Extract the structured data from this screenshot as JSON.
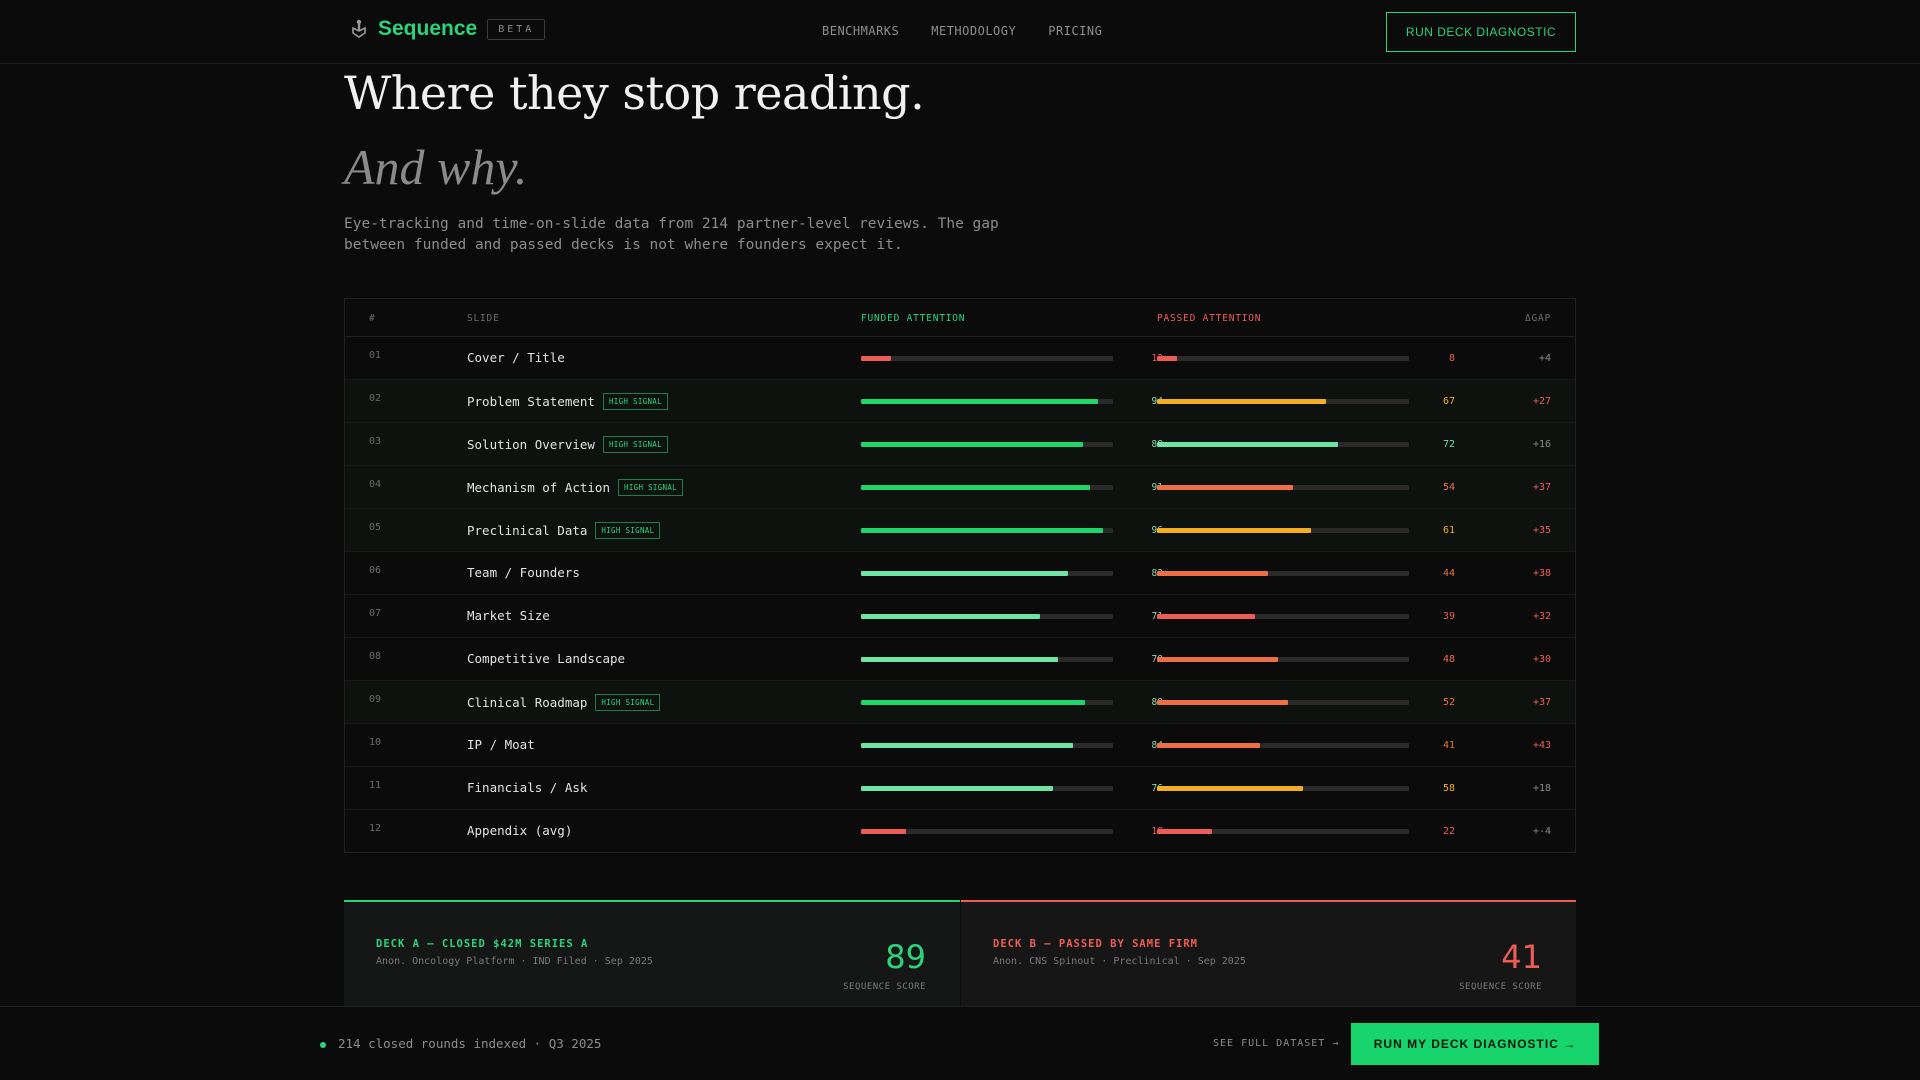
{
  "nav": {
    "brand": "Sequence",
    "beta": "BETA",
    "links": [
      "BENCHMARKS",
      "METHODOLOGY",
      "PRICING"
    ],
    "cta": "RUN DECK DIAGNOSTIC"
  },
  "hero": {
    "title": "Where they stop reading.",
    "subtitle": "And why.",
    "lede": "Eye-tracking and time-on-slide data from 214 partner-level reviews. The gap between funded and passed decks is not where founders expect it."
  },
  "table": {
    "headers": {
      "num": "#",
      "slide": "SLIDE",
      "funded": "FUNDED ATTENTION",
      "passed": "PASSED ATTENTION",
      "gap": "ΔGAP"
    },
    "badge_label": "HIGH SIGNAL",
    "colors": {
      "green": "#1fd66d",
      "mint": "#6fe3a3",
      "red": "#ee5d55",
      "orange": "#ef6f45",
      "amber": "#f4ae22",
      "low": "#ee5d55"
    },
    "rows": [
      {
        "num": "01",
        "slide": "Cover / Title",
        "signal": false,
        "funded": 12,
        "passed": 8,
        "gap": "+4",
        "fcolor": "#ee5d55",
        "pcolor": "#ee5d55",
        "fval_color": "#ee5d55",
        "gap_color": "#8a8a8a"
      },
      {
        "num": "02",
        "slide": "Problem Statement",
        "signal": true,
        "funded": 94,
        "passed": 67,
        "gap": "+27",
        "fcolor": "#1fd66d",
        "pcolor": "#f4ae22",
        "fval_color": "#8fd7ad",
        "gap_color": "#ee5d55"
      },
      {
        "num": "03",
        "slide": "Solution Overview",
        "signal": true,
        "funded": 88,
        "passed": 72,
        "gap": "+16",
        "fcolor": "#1fd66d",
        "pcolor": "#6fe3a3",
        "fval_color": "#8fd7ad",
        "gap_color": "#8a8a8a"
      },
      {
        "num": "04",
        "slide": "Mechanism of Action",
        "signal": true,
        "funded": 91,
        "passed": 54,
        "gap": "+37",
        "fcolor": "#1fd66d",
        "pcolor": "#ef6f45",
        "fval_color": "#8fd7ad",
        "gap_color": "#ee5d55"
      },
      {
        "num": "05",
        "slide": "Preclinical Data",
        "signal": true,
        "funded": 96,
        "passed": 61,
        "gap": "+35",
        "fcolor": "#1fd66d",
        "pcolor": "#f4ae22",
        "fval_color": "#8fd7ad",
        "gap_color": "#ee5d55"
      },
      {
        "num": "06",
        "slide": "Team / Founders",
        "signal": false,
        "funded": 82,
        "passed": 44,
        "gap": "+38",
        "fcolor": "#6fe3a3",
        "pcolor": "#ef6f45",
        "fval_color": "#8fd7ad",
        "gap_color": "#ee5d55"
      },
      {
        "num": "07",
        "slide": "Market Size",
        "signal": false,
        "funded": 71,
        "passed": 39,
        "gap": "+32",
        "fcolor": "#6fe3a3",
        "pcolor": "#ee5d55",
        "fval_color": "#8fd7ad",
        "gap_color": "#ee5d55"
      },
      {
        "num": "08",
        "slide": "Competitive Landscape",
        "signal": false,
        "funded": 78,
        "passed": 48,
        "gap": "+30",
        "fcolor": "#6fe3a3",
        "pcolor": "#ef6f45",
        "fval_color": "#8fd7ad",
        "gap_color": "#ee5d55"
      },
      {
        "num": "09",
        "slide": "Clinical Roadmap",
        "signal": true,
        "funded": 89,
        "passed": 52,
        "gap": "+37",
        "fcolor": "#1fd66d",
        "pcolor": "#ef6f45",
        "fval_color": "#8fd7ad",
        "gap_color": "#ee5d55"
      },
      {
        "num": "10",
        "slide": "IP / Moat",
        "signal": false,
        "funded": 84,
        "passed": 41,
        "gap": "+43",
        "fcolor": "#6fe3a3",
        "pcolor": "#ef6f45",
        "fval_color": "#8fd7ad",
        "gap_color": "#ee5d55"
      },
      {
        "num": "11",
        "slide": "Financials / Ask",
        "signal": false,
        "funded": 76,
        "passed": 58,
        "gap": "+18",
        "fcolor": "#6fe3a3",
        "pcolor": "#f4ae22",
        "fval_color": "#8fd7ad",
        "gap_color": "#8a8a8a"
      },
      {
        "num": "12",
        "slide": "Appendix (avg)",
        "signal": false,
        "funded": 18,
        "passed": 22,
        "gap": "+-4",
        "fcolor": "#ee5d55",
        "pcolor": "#ee5d55",
        "fval_color": "#ee5d55",
        "gap_color": "#8a8a8a"
      }
    ]
  },
  "decks": {
    "a": {
      "title": "DECK A — CLOSED $42M SERIES A",
      "sub": "Anon. Oncology Platform · IND Filed · Sep 2025",
      "score": "89",
      "score_label": "SEQUENCE SCORE",
      "color": "#2bd47a"
    },
    "b": {
      "title": "DECK B — PASSED BY SAME FIRM",
      "sub": "Anon. CNS Spinout · Preclinical · Sep 2025",
      "score": "41",
      "score_label": "SEQUENCE SCORE",
      "color": "#ee5d55"
    }
  },
  "footer": {
    "status": "214 closed rounds indexed · Q3 2025",
    "dataset_link": "SEE FULL DATASET →",
    "cta": "RUN MY DECK DIAGNOSTIC →"
  }
}
